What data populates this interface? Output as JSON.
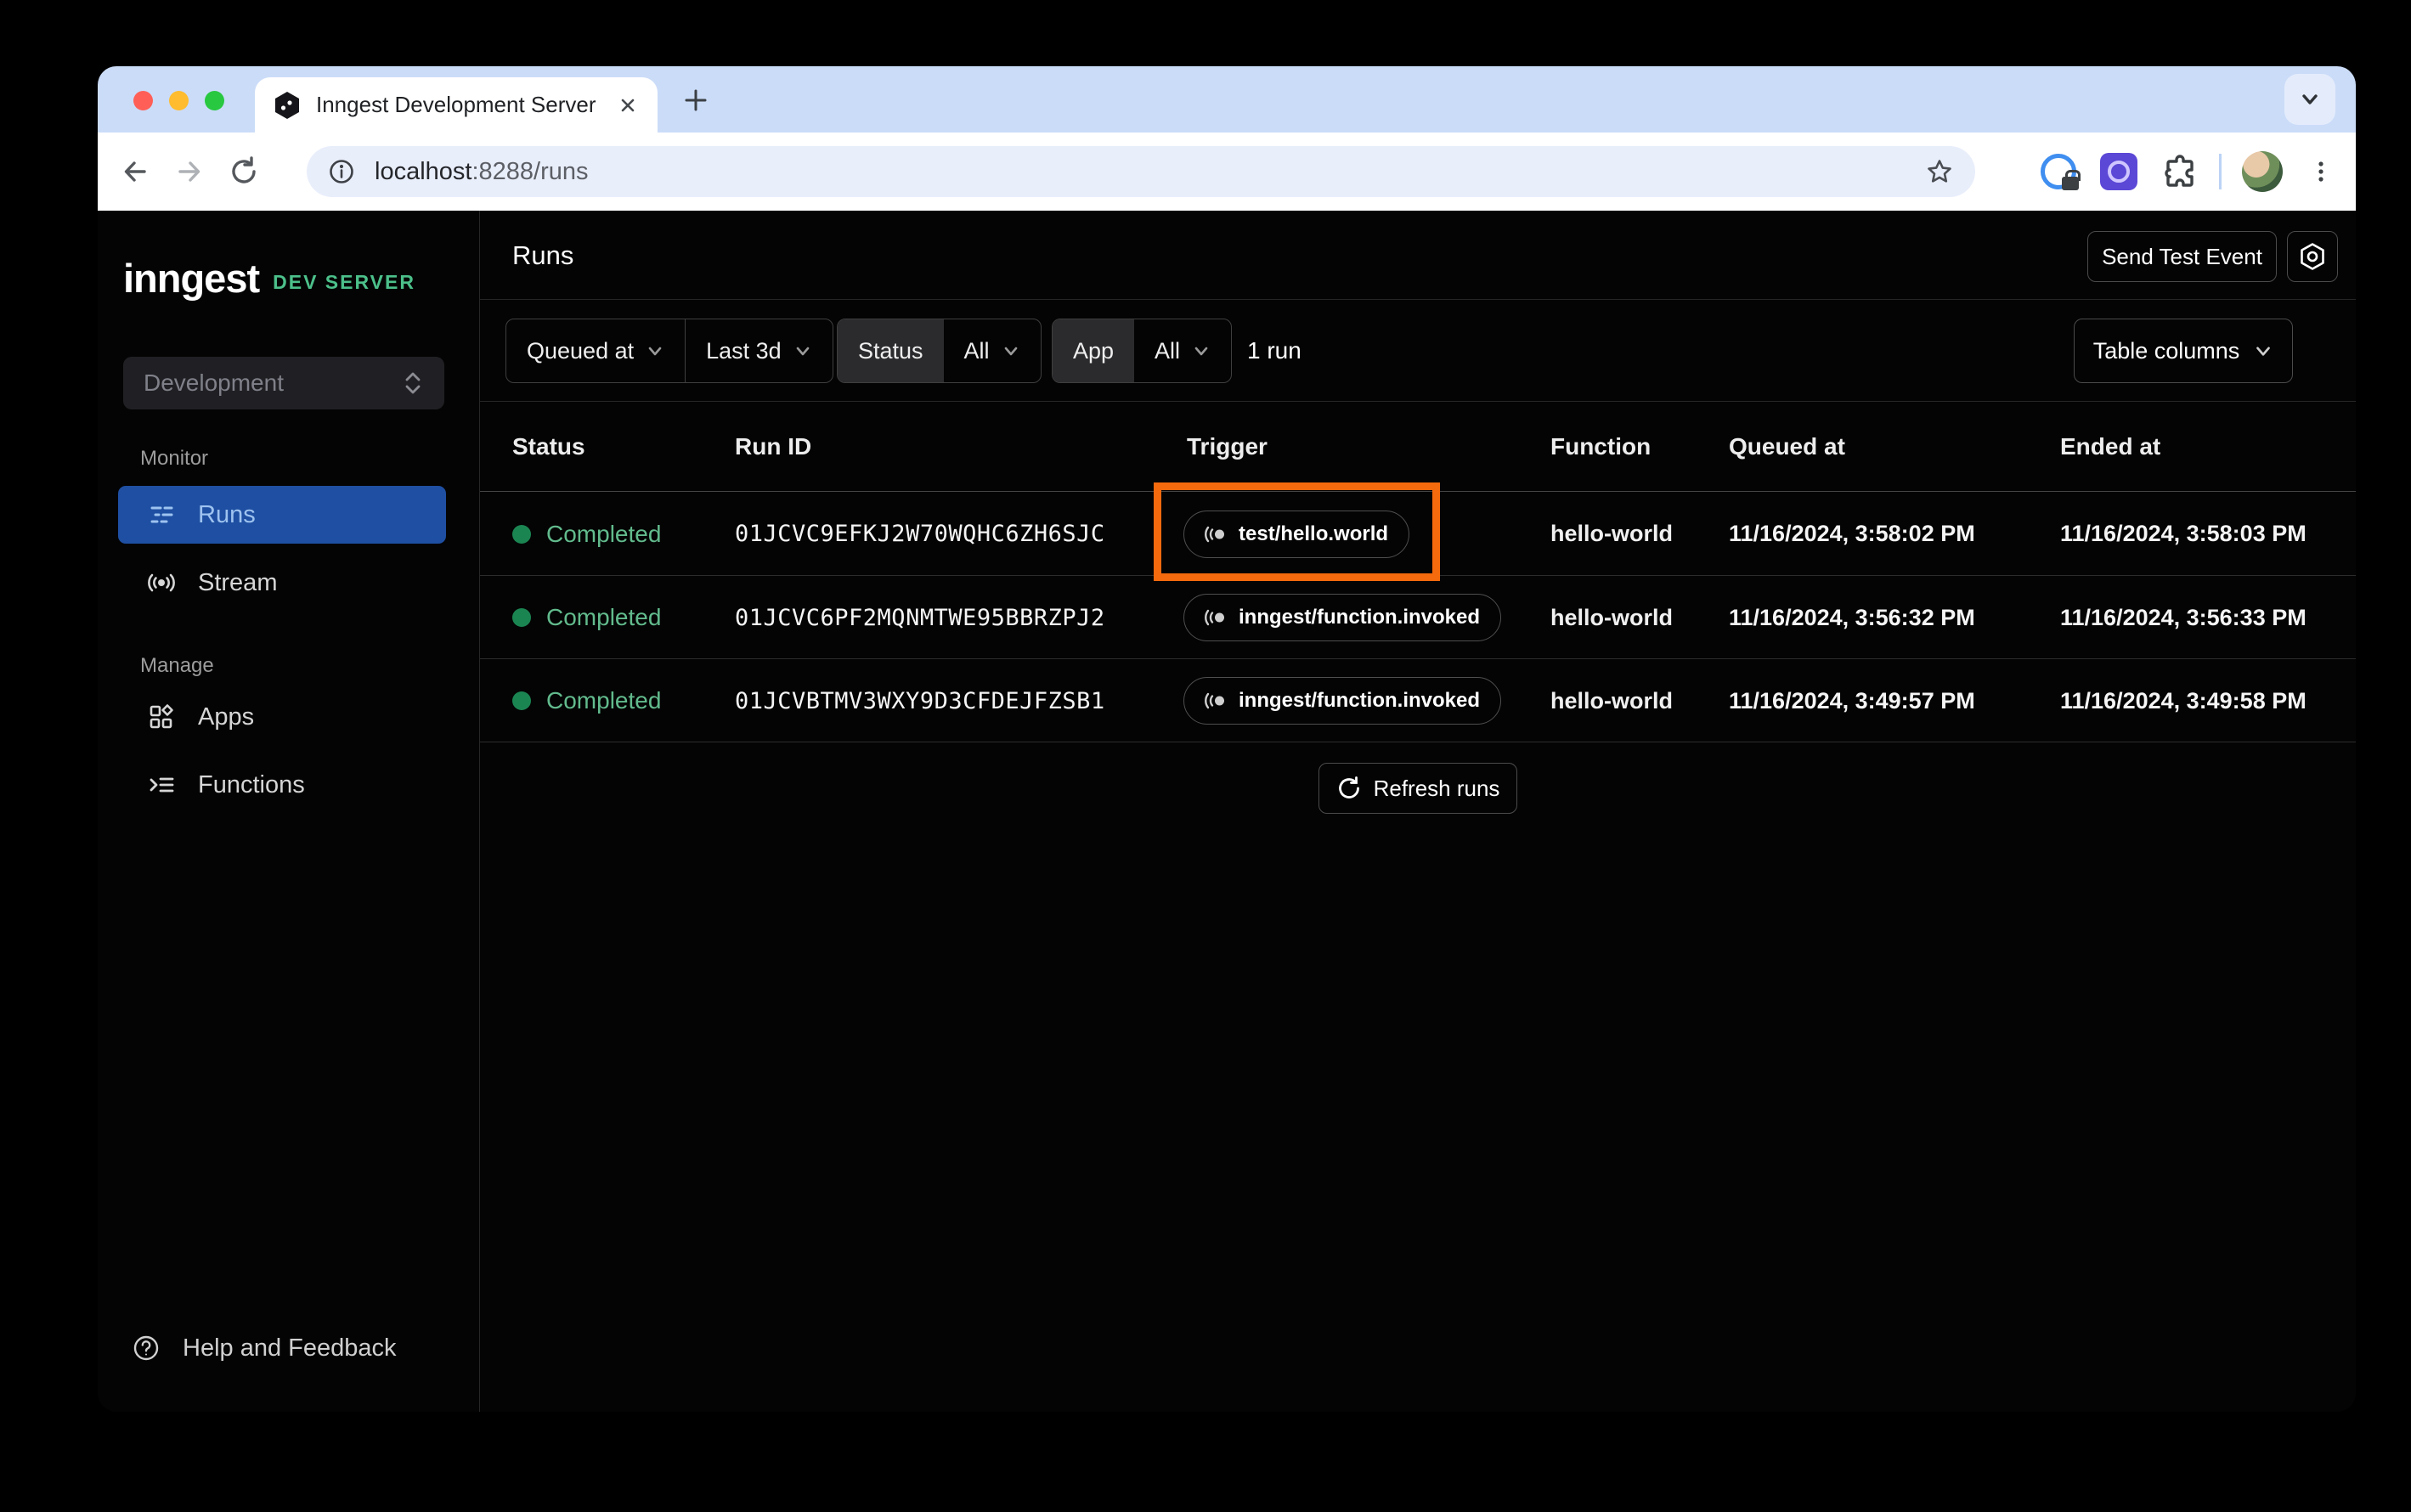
{
  "browser": {
    "tab_title": "Inngest Development Server",
    "url_host": "localhost",
    "url_path": ":8288/runs"
  },
  "sidebar": {
    "logo": "inngest",
    "logo_badge": "DEV SERVER",
    "environment": "Development",
    "monitor_label": "Monitor",
    "manage_label": "Manage",
    "items": {
      "runs": "Runs",
      "stream": "Stream",
      "apps": "Apps",
      "functions": "Functions"
    },
    "help": "Help and Feedback"
  },
  "header": {
    "title": "Runs",
    "send_test_event": "Send Test Event"
  },
  "filters": {
    "sort_field": "Queued at",
    "time_range": "Last 3d",
    "status_label": "Status",
    "status_value": "All",
    "app_label": "App",
    "app_value": "All",
    "run_count": "1 run",
    "table_columns": "Table columns"
  },
  "table": {
    "columns": [
      "Status",
      "Run ID",
      "Trigger",
      "Function",
      "Queued at",
      "Ended at"
    ],
    "rows": [
      {
        "status": "Completed",
        "run_id": "01JCVC9EFKJ2W70WQHC6ZH6SJC",
        "trigger": "test/hello.world",
        "function": "hello-world",
        "queued_at": "11/16/2024, 3:58:02 PM",
        "ended_at": "11/16/2024, 3:58:03 PM",
        "highlighted": true
      },
      {
        "status": "Completed",
        "run_id": "01JCVC6PF2MQNMTWE95BBRZPJ2",
        "trigger": "inngest/function.invoked",
        "function": "hello-world",
        "queued_at": "11/16/2024, 3:56:32 PM",
        "ended_at": "11/16/2024, 3:56:33 PM",
        "highlighted": false
      },
      {
        "status": "Completed",
        "run_id": "01JCVBTMV3WXY9D3CFDEJFZSB1",
        "trigger": "inngest/function.invoked",
        "function": "hello-world",
        "queued_at": "11/16/2024, 3:49:57 PM",
        "ended_at": "11/16/2024, 3:49:58 PM",
        "highlighted": false
      }
    ],
    "refresh_label": "Refresh runs"
  },
  "colors": {
    "highlight_orange": "#f56a0d",
    "status_dot_green": "#1b8552",
    "status_text_green": "#62bb8d",
    "active_nav_blue": "#1e4fa2",
    "active_nav_text": "#9ec3f0",
    "brand_green": "#4cc08a",
    "app_background": "#040404",
    "tabstrip_blue": "#cbdcf8"
  }
}
